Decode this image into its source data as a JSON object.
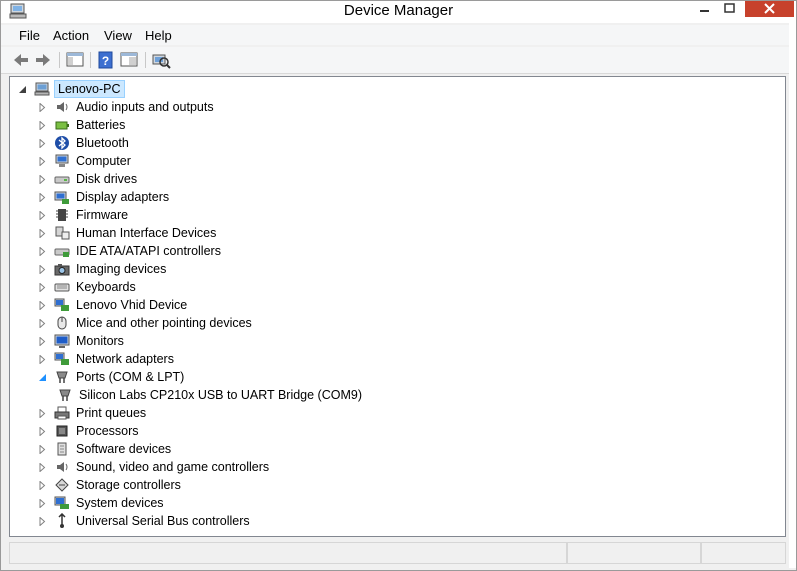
{
  "window": {
    "title": "Device Manager"
  },
  "menu": {
    "file": "File",
    "action": "Action",
    "view": "View",
    "help": "Help"
  },
  "tree": {
    "root": "Lenovo-PC",
    "categories": [
      {
        "label": "Audio inputs and outputs",
        "icon": "speaker-icon"
      },
      {
        "label": "Batteries",
        "icon": "battery-icon"
      },
      {
        "label": "Bluetooth",
        "icon": "bluetooth-icon"
      },
      {
        "label": "Computer",
        "icon": "computer-icon"
      },
      {
        "label": "Disk drives",
        "icon": "disk-drive-icon"
      },
      {
        "label": "Display adapters",
        "icon": "display-adapter-icon"
      },
      {
        "label": "Firmware",
        "icon": "firmware-icon"
      },
      {
        "label": "Human Interface Devices",
        "icon": "hid-icon"
      },
      {
        "label": "IDE ATA/ATAPI controllers",
        "icon": "ide-controller-icon"
      },
      {
        "label": "Imaging devices",
        "icon": "camera-icon"
      },
      {
        "label": "Keyboards",
        "icon": "keyboard-icon"
      },
      {
        "label": "Lenovo Vhid Device",
        "icon": "network-device-icon"
      },
      {
        "label": "Mice and other pointing devices",
        "icon": "mouse-icon"
      },
      {
        "label": "Monitors",
        "icon": "monitor-icon"
      },
      {
        "label": "Network adapters",
        "icon": "network-adapter-icon"
      },
      {
        "label": "Ports (COM & LPT)",
        "icon": "port-icon"
      },
      {
        "label": "Silicon Labs CP210x USB to UART Bridge (COM9)",
        "icon": "port-icon"
      },
      {
        "label": "Print queues",
        "icon": "printer-icon"
      },
      {
        "label": "Processors",
        "icon": "processor-icon"
      },
      {
        "label": "Software devices",
        "icon": "software-device-icon"
      },
      {
        "label": "Sound, video and game controllers",
        "icon": "sound-icon"
      },
      {
        "label": "Storage controllers",
        "icon": "storage-controller-icon"
      },
      {
        "label": "System devices",
        "icon": "system-device-icon"
      },
      {
        "label": "Universal Serial Bus controllers",
        "icon": "usb-icon"
      }
    ]
  },
  "colors": {
    "selection": "#cce8ff",
    "close_button": "#c7412c",
    "arrow": "#808080",
    "expanded_arrow": "#1e90ff"
  }
}
